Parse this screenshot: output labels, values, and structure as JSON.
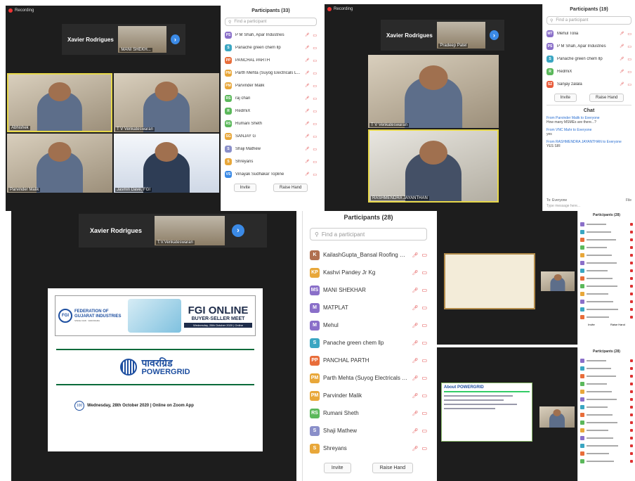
{
  "colors": {
    "zoom_bg": "#1d1d1d",
    "accent": "#3b8ae6",
    "muted_icon": "#d33",
    "active_border": "#e7d84a"
  },
  "recording": "Recording",
  "s1": {
    "speaker": "Xavier Rodrigues",
    "thumb": "MANI SHEKH...",
    "tiles": [
      "Abhishek",
      "T V Venkateswaran",
      "Parvinder Malik",
      "Jasmin Dave, FGI"
    ],
    "panel_title": "Participants (33)",
    "search": "Find a participant",
    "participants": [
      {
        "init": "PS",
        "name": "P M Shah, Apar Industries",
        "color": "#8a6fc9"
      },
      {
        "init": "S",
        "name": "Panache green chem llp",
        "color": "#3aa6c2"
      },
      {
        "init": "PP",
        "name": "PANCHAL PARTH",
        "color": "#e86d3a"
      },
      {
        "init": "PM",
        "name": "Parth Mehta (Suyog Electricals L...",
        "color": "#e8a73a"
      },
      {
        "init": "PM",
        "name": "Parvinder Malik",
        "color": "#e8a73a"
      },
      {
        "init": "RS",
        "name": "raj chan",
        "color": "#5bb85b"
      },
      {
        "init": "R",
        "name": "RedmiX",
        "color": "#5bb85b"
      },
      {
        "init": "RS",
        "name": "Rumani Sheth",
        "color": "#5bb85b"
      },
      {
        "init": "SG",
        "name": "SANJAY G",
        "color": "#e8a73a"
      },
      {
        "init": "S",
        "name": "Shaji Mathew",
        "color": "#8a8fc9"
      },
      {
        "init": "S",
        "name": "Shreyans",
        "color": "#e8a73a"
      },
      {
        "init": "VS",
        "name": "Vinayak Sudhakar  Topline",
        "color": "#3a8ae6"
      }
    ],
    "invite": "Invite",
    "raise": "Raise Hand"
  },
  "s2": {
    "speaker": "Xavier Rodrigues",
    "thumb": "Pradeep Patel",
    "tiles": [
      "T V Venkateswaran",
      "RASHMENDRA JAYANTHAN"
    ],
    "panel_title": "Participants (19)",
    "search": "Find a participant",
    "participants": [
      {
        "init": "MT",
        "name": "Mehul Tolia",
        "color": "#8a6fc9"
      },
      {
        "init": "PS",
        "name": "P M Shah, Apar Industries",
        "color": "#8a6fc9"
      },
      {
        "init": "S",
        "name": "Panache green chem llp",
        "color": "#3aa6c2"
      },
      {
        "init": "R",
        "name": "RedmiX",
        "color": "#5bb85b"
      },
      {
        "init": "SZ",
        "name": "Sanjay zalala",
        "color": "#e85a3a"
      }
    ],
    "invite": "Invite",
    "raise": "Raise Hand",
    "chat_title": "Chat",
    "chat": [
      {
        "from": "From Parvinder Malik to Everyone",
        "msg": "How many MSMEs are there...?"
      },
      {
        "from": "From VNC Mahr to Everyone",
        "msg": "yes"
      },
      {
        "from": "From RASHMENDRA JAYANTHAN to Everyone",
        "msg": "YES SIR"
      }
    ],
    "to": "To: Everyone",
    "file": "File",
    "placeholder": "Type message here..."
  },
  "s3": {
    "speaker": "Xavier Rodrigues",
    "thumb": "T.V.Venkateswaran",
    "fgi_name": "FEDERATION OF GUJARAT INDUSTRIES",
    "fgi_sub": "SINCE 1918 · VADODARA",
    "event_title": "FGI ONLINE",
    "event_sub": "BUYER-SELLER MEET",
    "event_date": "Wednesday, 28th October 2020 | Online",
    "pg_hindi": "पावरग्रिड",
    "pg_eng": "POWERGRID",
    "footer": "Wednesday, 28th October 2020 | Online on Zoom App",
    "years": "100"
  },
  "s4": {
    "panel_title": "Participants (28)",
    "search": "Find a participant",
    "participants": [
      {
        "init": "K",
        "name": "KailashGupta_Bansal Roofing Pr...",
        "color": "#b07050"
      },
      {
        "init": "KP",
        "name": "Kashvi Pandey Jr Kg",
        "color": "#e8a73a"
      },
      {
        "init": "MS",
        "name": "MANI SHEKHAR",
        "color": "#8a6fc9"
      },
      {
        "init": "M",
        "name": "MATPLAT",
        "color": "#8a6fc9"
      },
      {
        "init": "M",
        "name": "Mehul",
        "color": "#8a6fc9"
      },
      {
        "init": "S",
        "name": "Panache green chem llp",
        "color": "#3aa6c2"
      },
      {
        "init": "PP",
        "name": "PANCHAL PARTH",
        "color": "#e86d3a"
      },
      {
        "init": "PM",
        "name": "Parth Mehta (Suyog Electricals L...",
        "color": "#e8a73a"
      },
      {
        "init": "PM",
        "name": "Parvinder Malik",
        "color": "#e8a73a"
      },
      {
        "init": "RS",
        "name": "Rumani Sheth",
        "color": "#5bb85b"
      },
      {
        "init": "S",
        "name": "Shaji Mathew",
        "color": "#8a8fc9"
      },
      {
        "init": "S",
        "name": "Shreyans",
        "color": "#e8a73a"
      }
    ],
    "invite": "Invite",
    "raise": "Raise Hand"
  },
  "s5": {
    "slide_title": "About POWERGRID",
    "panel_a": "Participants (28)",
    "panel_b": "Participants (28)",
    "btn_a": "Invite",
    "btn_b": "Raise Hand"
  }
}
